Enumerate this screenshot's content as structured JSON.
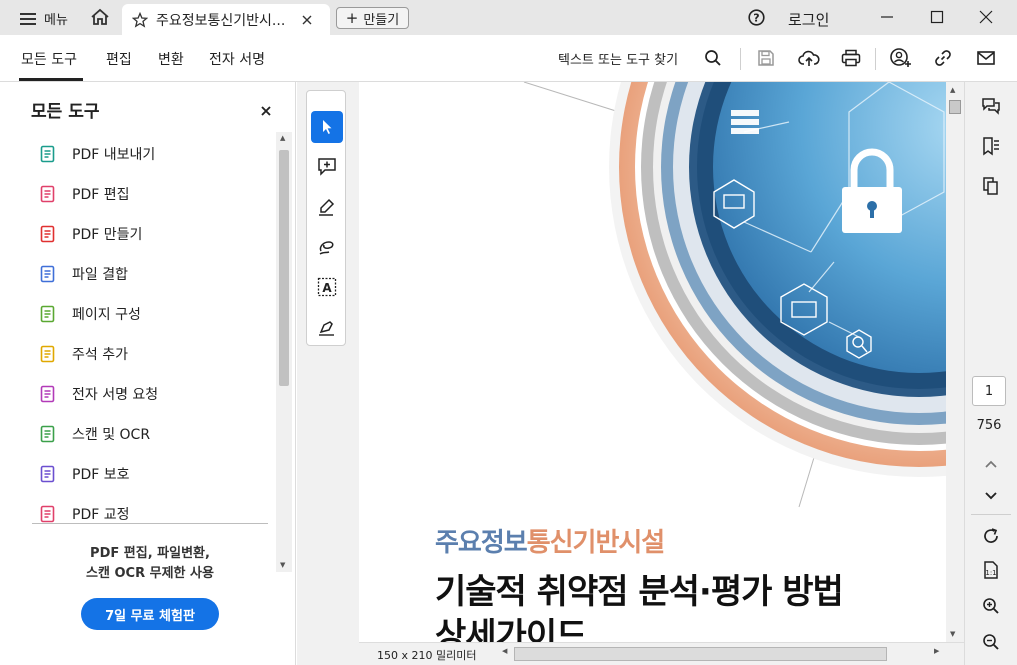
{
  "titlebar": {
    "menu_label": "메뉴",
    "tab_title": "주요정보통신기반시...",
    "create_label": "만들기",
    "login_label": "로그인"
  },
  "toolbar": {
    "tabs": [
      "모든 도구",
      "편집",
      "변환",
      "전자 서명"
    ],
    "search_label": "텍스트 또는 도구 찾기"
  },
  "left_panel": {
    "title": "모든 도구",
    "items": [
      {
        "label": "PDF 내보내기",
        "icon": "pdf-export-icon",
        "color": "#1a9c8c"
      },
      {
        "label": "PDF 편집",
        "icon": "pdf-edit-icon",
        "color": "#e0406a"
      },
      {
        "label": "PDF 만들기",
        "icon": "pdf-create-icon",
        "color": "#e03030"
      },
      {
        "label": "파일 결합",
        "icon": "combine-files-icon",
        "color": "#3f6fd8"
      },
      {
        "label": "페이지 구성",
        "icon": "organize-pages-icon",
        "color": "#5aa832"
      },
      {
        "label": "주석 추가",
        "icon": "comment-icon",
        "color": "#e0a800"
      },
      {
        "label": "전자 서명 요청",
        "icon": "request-signature-icon",
        "color": "#b23ab8"
      },
      {
        "label": "스캔 및 OCR",
        "icon": "scan-ocr-icon",
        "color": "#3ba04a"
      },
      {
        "label": "PDF 보호",
        "icon": "protect-pdf-icon",
        "color": "#6b4fd0"
      },
      {
        "label": "PDF 교정",
        "icon": "redact-icon",
        "color": "#e0406a"
      }
    ],
    "promo_line1": "PDF 편집, 파일변환,",
    "promo_line2": "스캔 OCR 무제한 사용",
    "trial_button": "7일 무료 체험판"
  },
  "document": {
    "subtitle": "주요정보통신기반시설",
    "title_line1": "기술적 취약점 분석·평가 방법",
    "title_line2": "상세가이드",
    "page_size": "150 x 210 밀리미터"
  },
  "pagination": {
    "current_page": "1",
    "total_pages": "756"
  },
  "colors": {
    "accent": "#1473e6",
    "subtitle_blue": "#5b7fae",
    "subtitle_orange": "#e0906a"
  }
}
